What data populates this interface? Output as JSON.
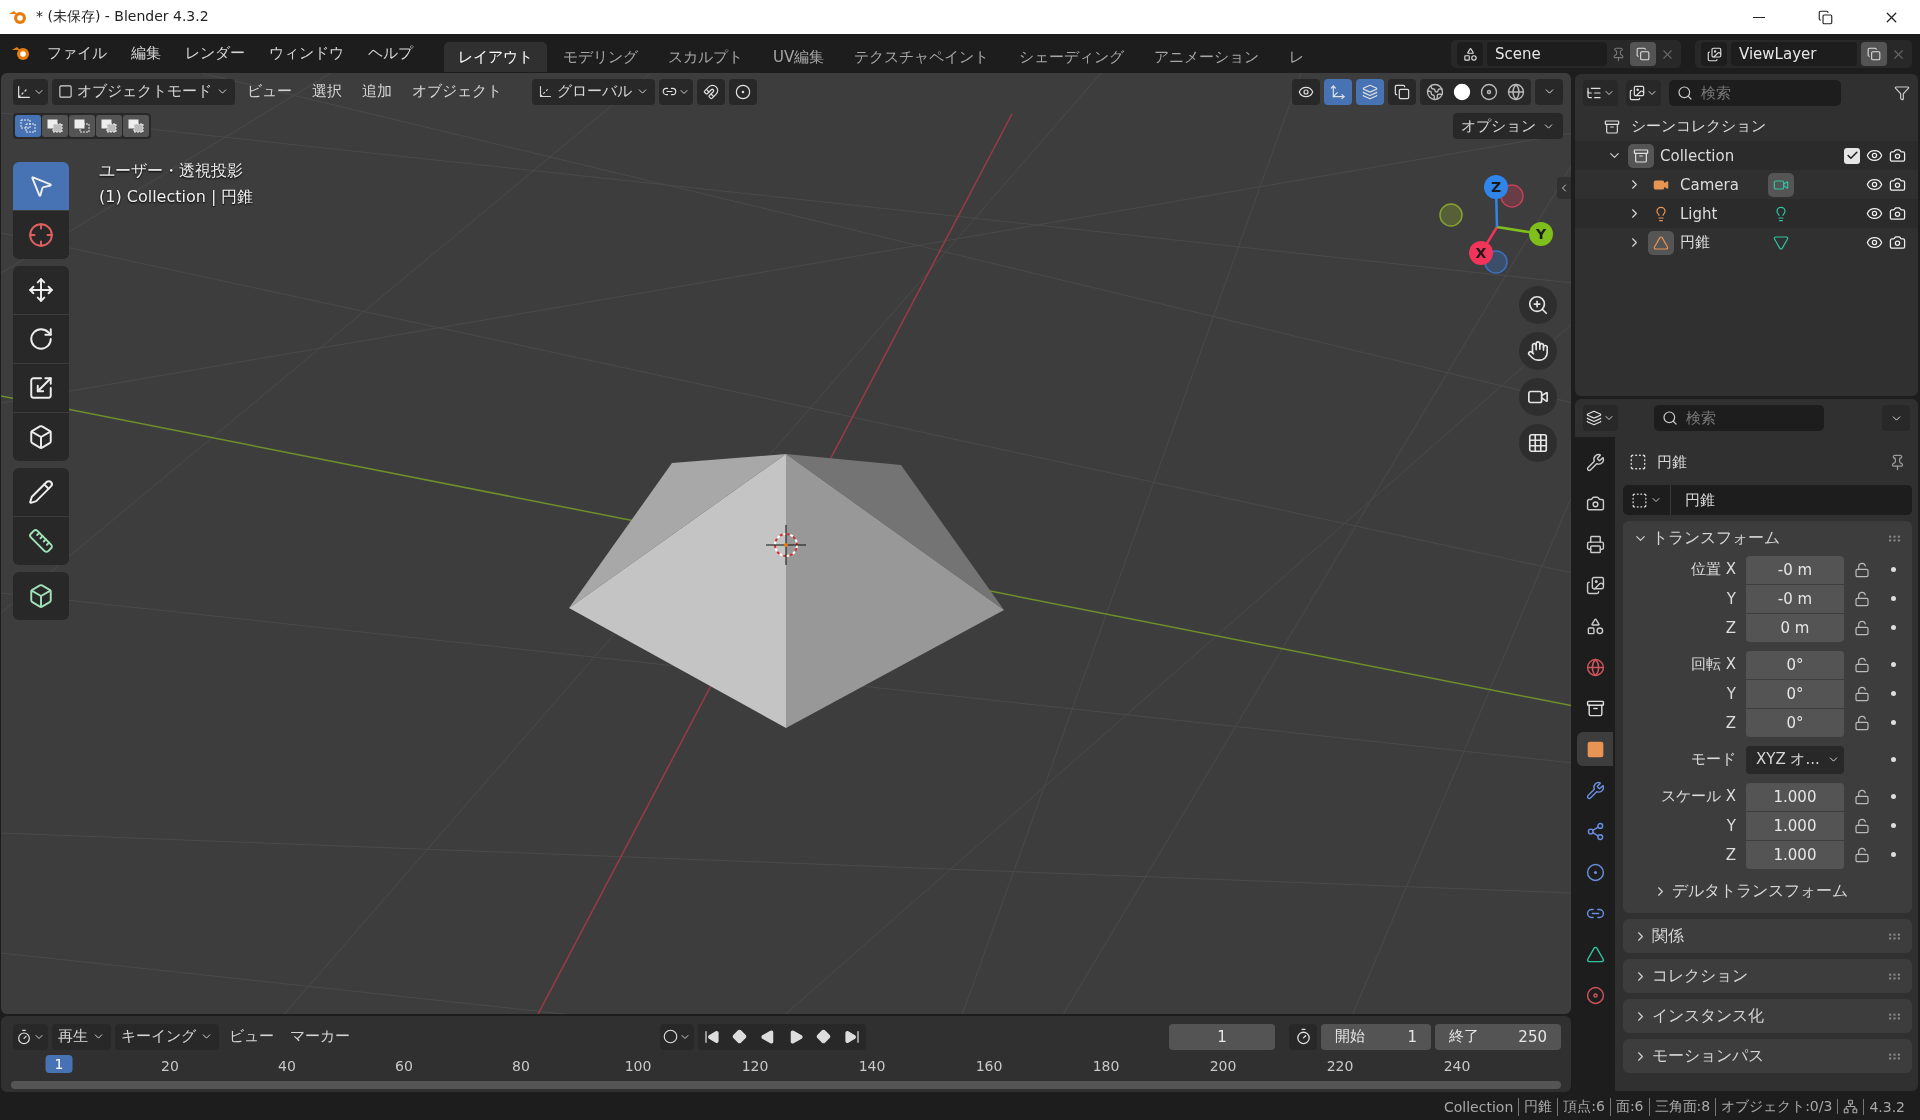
{
  "window": {
    "title": "* (未保存) - Blender 4.3.2"
  },
  "menu_bar": {
    "menus": [
      "ファイル",
      "編集",
      "レンダー",
      "ウィンドウ",
      "ヘルプ"
    ],
    "workspaces": [
      {
        "label": "レイアウト",
        "selected": true
      },
      {
        "label": "モデリング",
        "selected": false
      },
      {
        "label": "スカルプト",
        "selected": false
      },
      {
        "label": "UV編集",
        "selected": false
      },
      {
        "label": "テクスチャペイント",
        "selected": false
      },
      {
        "label": "シェーディング",
        "selected": false
      },
      {
        "label": "アニメーション",
        "selected": false
      },
      {
        "label": "レ",
        "selected": false
      }
    ],
    "scene": "Scene",
    "view_layer": "ViewLayer"
  },
  "viewport": {
    "mode": "オブジェクトモード",
    "menus": [
      "ビュー",
      "選択",
      "追加",
      "オブジェクト"
    ],
    "orientation": "グローバル",
    "toggles": [
      {
        "kind": "snap",
        "on": false
      },
      {
        "kind": "proportional",
        "on": false
      },
      {
        "kind": "visibility",
        "on": false
      },
      {
        "kind": "gizmo",
        "on": true
      },
      {
        "kind": "overlay",
        "on": true
      },
      {
        "kind": "xray",
        "on": false
      }
    ],
    "shading": [
      {
        "kind": "wireframe",
        "selected": false
      },
      {
        "kind": "solid",
        "selected": true
      },
      {
        "kind": "material",
        "selected": false
      },
      {
        "kind": "rendered",
        "selected": false
      }
    ],
    "select_modes": [
      {
        "kind": "set",
        "selected": true
      },
      {
        "kind": "extend",
        "selected": false
      },
      {
        "kind": "subtract",
        "selected": false
      },
      {
        "kind": "invert",
        "selected": false
      },
      {
        "kind": "intersect",
        "selected": false
      }
    ],
    "options": "オプション",
    "view_name": "ユーザー・透視投影",
    "context": "(1) Collection | 円錐",
    "tools": [
      {
        "kind": "select",
        "selected": true
      },
      {
        "kind": "cursor",
        "selected": false
      },
      {
        "kind": "move",
        "selected": false
      },
      {
        "kind": "rotate",
        "selected": false
      },
      {
        "kind": "scale",
        "selected": false
      },
      {
        "kind": "transform",
        "selected": false
      },
      {
        "kind": "annotate",
        "selected": false
      },
      {
        "kind": "measure",
        "selected": false
      },
      {
        "kind": "add_cube",
        "selected": false
      }
    ],
    "axes": [
      "X",
      "Y",
      "Z"
    ]
  },
  "outliner": {
    "search_placeholder": "検索",
    "scene_collection": "シーンコレクション",
    "tree": [
      {
        "name": "Collection",
        "kind": "collection",
        "expanded": true,
        "checked": true,
        "children": [
          {
            "name": "Camera",
            "kind": "camera",
            "expanded": false
          },
          {
            "name": "Light",
            "kind": "light",
            "expanded": false
          },
          {
            "name": "円錐",
            "kind": "mesh",
            "expanded": false
          }
        ]
      }
    ]
  },
  "properties": {
    "search_placeholder": "検索",
    "tabs": [
      {
        "kind": "tool",
        "selected": false
      },
      {
        "kind": "render",
        "selected": false
      },
      {
        "kind": "output",
        "selected": false
      },
      {
        "kind": "view_layer",
        "selected": false
      },
      {
        "kind": "scene",
        "selected": false
      },
      {
        "kind": "world",
        "selected": false
      },
      {
        "kind": "collection",
        "selected": false
      },
      {
        "kind": "object",
        "selected": true
      },
      {
        "kind": "modifiers",
        "selected": false
      },
      {
        "kind": "particles",
        "selected": false
      },
      {
        "kind": "physics",
        "selected": false
      },
      {
        "kind": "constraints",
        "selected": false
      },
      {
        "kind": "data",
        "selected": false
      },
      {
        "kind": "material",
        "selected": false
      }
    ],
    "object_name": "円錐",
    "name_field": "円錐",
    "transform": {
      "title": "トランスフォーム",
      "expanded": true,
      "rows": [
        {
          "kind": "field",
          "label": "位置",
          "axis": "X",
          "value": "-0 m"
        },
        {
          "kind": "field",
          "axis": "Y",
          "value": "-0 m"
        },
        {
          "kind": "field",
          "axis": "Z",
          "value": "0 m"
        },
        {
          "kind": "field",
          "label": "回転",
          "axis": "X",
          "value": "0°"
        },
        {
          "kind": "field",
          "axis": "Y",
          "value": "0°"
        },
        {
          "kind": "field",
          "axis": "Z",
          "value": "0°"
        },
        {
          "kind": "dropdown",
          "label": "モード",
          "value": "XYZ オ..."
        },
        {
          "kind": "field",
          "label": "スケール",
          "axis": "X",
          "value": "1.000"
        },
        {
          "kind": "field",
          "axis": "Y",
          "value": "1.000"
        },
        {
          "kind": "field",
          "axis": "Z",
          "value": "1.000"
        }
      ],
      "delta": {
        "title": "デルタトランスフォーム",
        "expanded": false
      }
    },
    "panels": [
      {
        "title": "関係",
        "expanded": false
      },
      {
        "title": "コレクション",
        "expanded": false
      },
      {
        "title": "インスタンス化",
        "expanded": false
      },
      {
        "title": "モーションパス",
        "expanded": false
      }
    ]
  },
  "timeline": {
    "menus": [
      {
        "label": "再生",
        "dropdown": true
      },
      {
        "label": "キーイング",
        "dropdown": true
      },
      {
        "label": "ビュー",
        "dropdown": false
      },
      {
        "label": "マーカー",
        "dropdown": false
      }
    ],
    "current_frame": "1",
    "start_label": "開始",
    "start": "1",
    "end_label": "終了",
    "end": "250",
    "playhead": "1",
    "ruler": [
      "20",
      "40",
      "60",
      "80",
      "100",
      "120",
      "140",
      "160",
      "180",
      "200",
      "220",
      "240"
    ]
  },
  "status_bar": {
    "items": [
      "Collection",
      "円錐",
      "頂点:6",
      "面:6",
      "三角面:8",
      "オブジェクト:0/3"
    ],
    "version": "4.3.2"
  }
}
